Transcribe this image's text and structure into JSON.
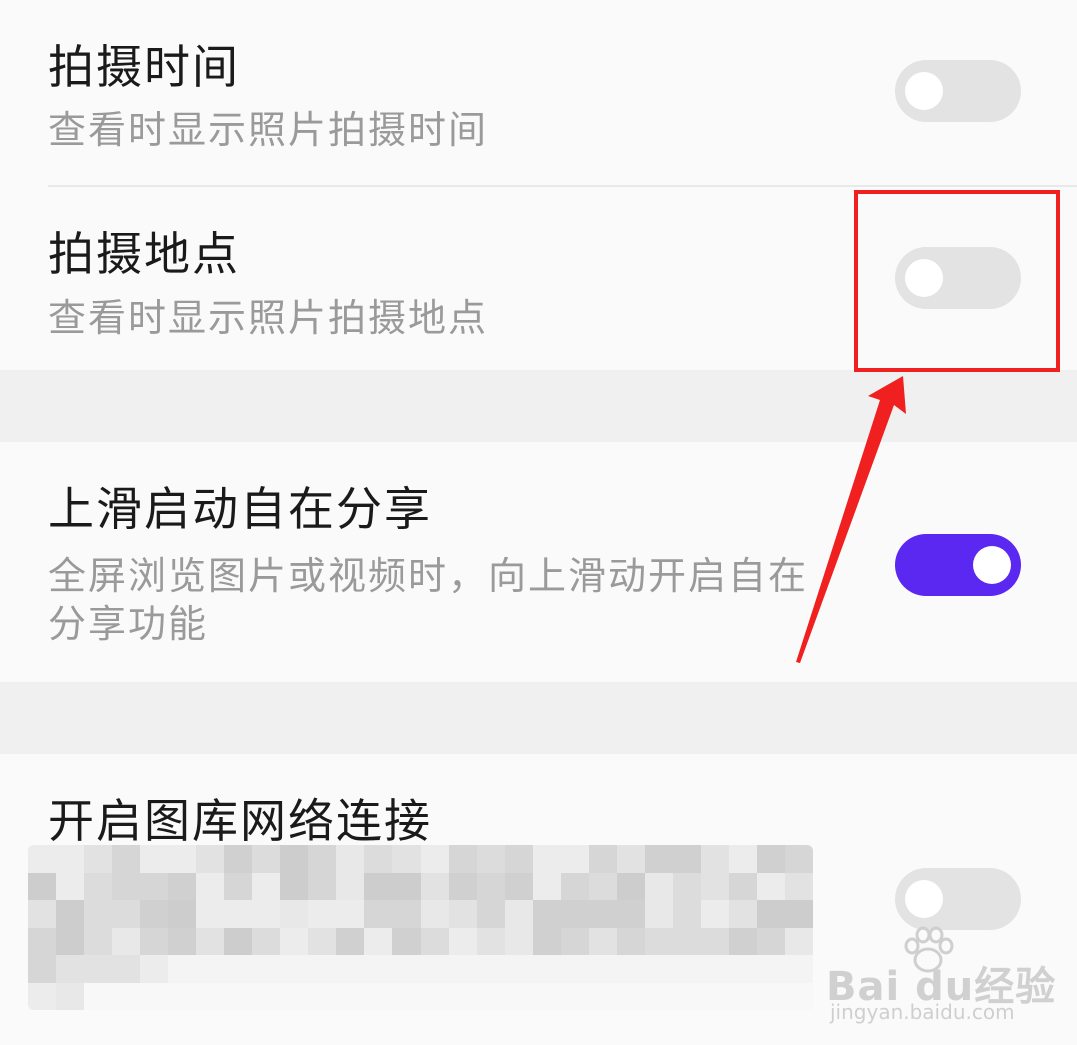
{
  "settings": {
    "shooting_time": {
      "title": "拍摄时间",
      "subtitle": "查看时显示照片拍摄时间",
      "enabled": false
    },
    "shooting_location": {
      "title": "拍摄地点",
      "subtitle": "查看时显示照片拍摄地点",
      "enabled": false
    },
    "swipe_up_share": {
      "title": "上滑启动自在分享",
      "subtitle": "全屏浏览图片或视频时，向上滑动开启自在分享功能",
      "enabled": true
    },
    "gallery_network": {
      "title": "开启图库网络连接",
      "subtitle_obscured": true,
      "enabled": false
    }
  },
  "colors": {
    "switch_on": "#5a28f0",
    "switch_off": "#e3e3e3",
    "annotation": "#f02020"
  },
  "watermark": {
    "brand": "Bai du经验",
    "url": "jingyan.baidu.com"
  }
}
